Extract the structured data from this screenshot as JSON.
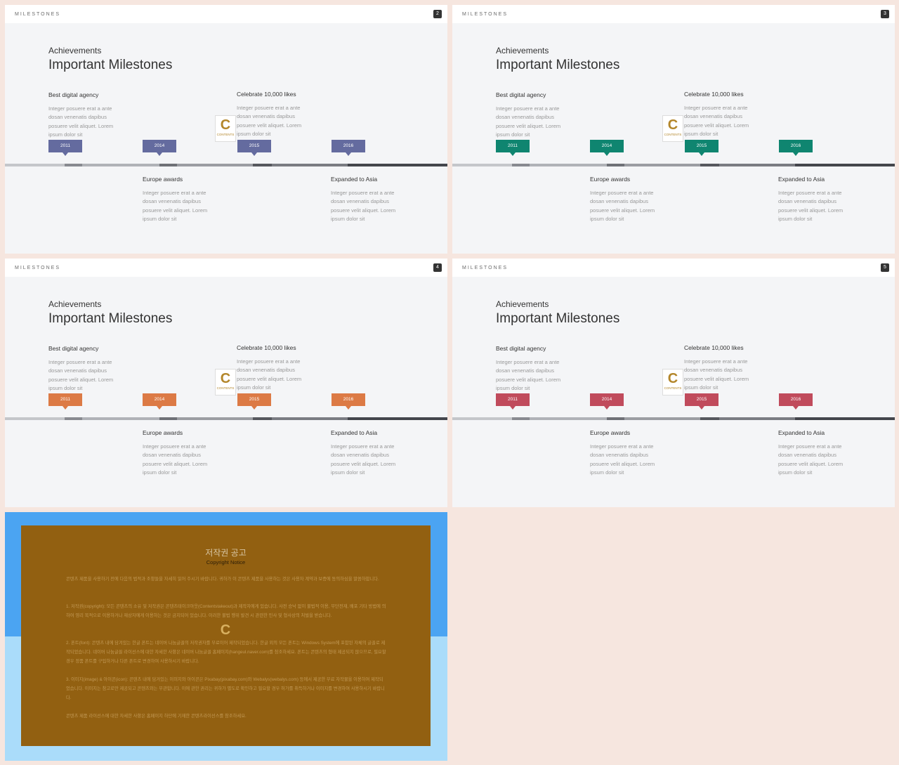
{
  "slides": [
    {
      "section": "MILESTONES",
      "number": "2",
      "accent": "#646b9f",
      "subtitle": "Achievements",
      "title": "Important Milestones",
      "items": {
        "best": {
          "heading": "Best digital agency",
          "body": "Integer posuere erat a ante dosan venenatis dapibus posuere velit aliquet. Lorem ipsum dolor sit"
        },
        "celebrate": {
          "heading": "Celebrate  10,000 likes",
          "body": "Integer posuere erat a ante dosan venenatis dapibus posuere velit aliquet. Lorem ipsum dolor sit"
        },
        "europe": {
          "heading": "Europe awards",
          "body": "Integer posuere erat a ante dosan venenatis dapibus posuere velit aliquet. Lorem ipsum dolor sit"
        },
        "asia": {
          "heading": "Expanded to Asia",
          "body": "Integer posuere erat a ante dosan venenatis dapibus posuere velit aliquet. Lorem ipsum dolor sit"
        }
      },
      "years": [
        "2011",
        "2014",
        "2015",
        "2016"
      ]
    },
    {
      "section": "MILESTONES",
      "number": "3",
      "accent": "#0f8570",
      "subtitle": "Achievements",
      "title": "Important Milestones",
      "items": {
        "best": {
          "heading": "Best digital agency",
          "body": "Integer posuere erat a ante dosan venenatis dapibus posuere velit aliquet. Lorem ipsum dolor sit"
        },
        "celebrate": {
          "heading": "Celebrate  10,000 likes",
          "body": "Integer posuere erat a ante dosan venenatis dapibus posuere velit aliquet. Lorem ipsum dolor sit"
        },
        "europe": {
          "heading": "Europe awards",
          "body": "Integer posuere erat a ante dosan venenatis dapibus posuere velit aliquet. Lorem ipsum dolor sit"
        },
        "asia": {
          "heading": "Expanded to Asia",
          "body": "Integer posuere erat a ante dosan venenatis dapibus posuere velit aliquet. Lorem ipsum dolor sit"
        }
      },
      "years": [
        "2011",
        "2014",
        "2015",
        "2016"
      ]
    },
    {
      "section": "MILESTONES",
      "number": "4",
      "accent": "#dc7a45",
      "subtitle": "Achievements",
      "title": "Important Milestones",
      "items": {
        "best": {
          "heading": "Best digital agency",
          "body": "Integer posuere erat a ante dosan venenatis dapibus posuere velit aliquet. Lorem ipsum dolor sit"
        },
        "celebrate": {
          "heading": "Celebrate  10,000 likes",
          "body": "Integer posuere erat a ante dosan venenatis dapibus posuere velit aliquet. Lorem ipsum dolor sit"
        },
        "europe": {
          "heading": "Europe awards",
          "body": "Integer posuere erat a ante dosan venenatis dapibus posuere velit aliquet. Lorem ipsum dolor sit"
        },
        "asia": {
          "heading": "Expanded to Asia",
          "body": "Integer posuere erat a ante dosan venenatis dapibus posuere velit aliquet. Lorem ipsum dolor sit"
        }
      },
      "years": [
        "2011",
        "2014",
        "2015",
        "2016"
      ]
    },
    {
      "section": "MILESTONES",
      "number": "5",
      "accent": "#c04b5c",
      "subtitle": "Achievements",
      "title": "Important Milestones",
      "items": {
        "best": {
          "heading": "Best digital agency",
          "body": "Integer posuere erat a ante dosan venenatis dapibus posuere velit aliquet. Lorem ipsum dolor sit"
        },
        "celebrate": {
          "heading": "Celebrate  10,000 likes",
          "body": "Integer posuere erat a ante dosan venenatis dapibus posuere velit aliquet. Lorem ipsum dolor sit"
        },
        "europe": {
          "heading": "Europe awards",
          "body": "Integer posuere erat a ante dosan venenatis dapibus posuere velit aliquet. Lorem ipsum dolor sit"
        },
        "asia": {
          "heading": "Expanded to Asia",
          "body": "Integer posuere erat a ante dosan venenatis dapibus posuere velit aliquet. Lorem ipsum dolor sit"
        }
      },
      "years": [
        "2011",
        "2014",
        "2015",
        "2016"
      ]
    }
  ],
  "logo": {
    "letter": "C",
    "text": "CONTENTS"
  },
  "notice": {
    "title": "저작권 공고",
    "subtitle": "Copyright Notice",
    "p1": "콘텐츠 제품을 사용하기 전에 다음의 법적과 조항들을 자세히 읽어 주시기 바랍니다. 귀하가 이 콘텐츠 제품을 사용하는 것은 사용자 계약과 보증에 동의하심을 말씀하합니다.",
    "p2": "1. 저작권(copyright): 모든 콘텐츠의 소유 및 저작권은 콘텐츠테이크아웃(Contentstakeout)과 제작자에게 있습니다. 사전 승낙 없이 불법적 이용, 무단전재, 배포 기타 방법에 의하여 영리 목적으로 이용하거나 재상자에게 이용하는 것은 금지되어 있습니다. 이러한 불법 행위 발견 시 관련한 민사 및 형사상의 처벌을 받습니다.",
    "p3": "2. 폰트(font): 콘텐츠 내에 담겨있는 한글 폰트는 네이버 나눔글꼴의 저작권자를 무료이어 제작되었습니다. 한글 외의 모든 폰트는 Windows System에 포함된 자체의 글꼴로 제작되었습니다. 네이버 나눔글꼴 라이선스에 대한 자세한 사항은 네이버 나눔글꼴 홈페이지(hangeul.naver.com)를 참조하세요. 폰트는 콘텐츠의 형태 제공되지 않으므로, 필요할 경우 정품 폰트를 구입하거나 다른 폰트로 변경하여 사용하시기 바랍니다.",
    "p4": "3. 이미지(image) & 아이콘(icon): 콘텐츠 내에 담겨있는 이미지와 아이콘은 Pixabay(pixabay.com)와 Webalys(webalys.com) 등에서 제공한 무료 자작물을 이용하여 제작되었습니다. 이미지는 참고로만 제공되고 콘텐츠와는 무관합니다. 이에 관한 권리는 귀하가 별도로 확인하고 필요할 경우 허가를 취득하거나 이미지를 변경하여 사용하시기 바랍니다.",
    "p5": "콘텐츠 제품 라이선스에 대한 자세한 사항은 홈페이지 하단에 기재한 콘텐츠라이선스를 참조하세요."
  }
}
